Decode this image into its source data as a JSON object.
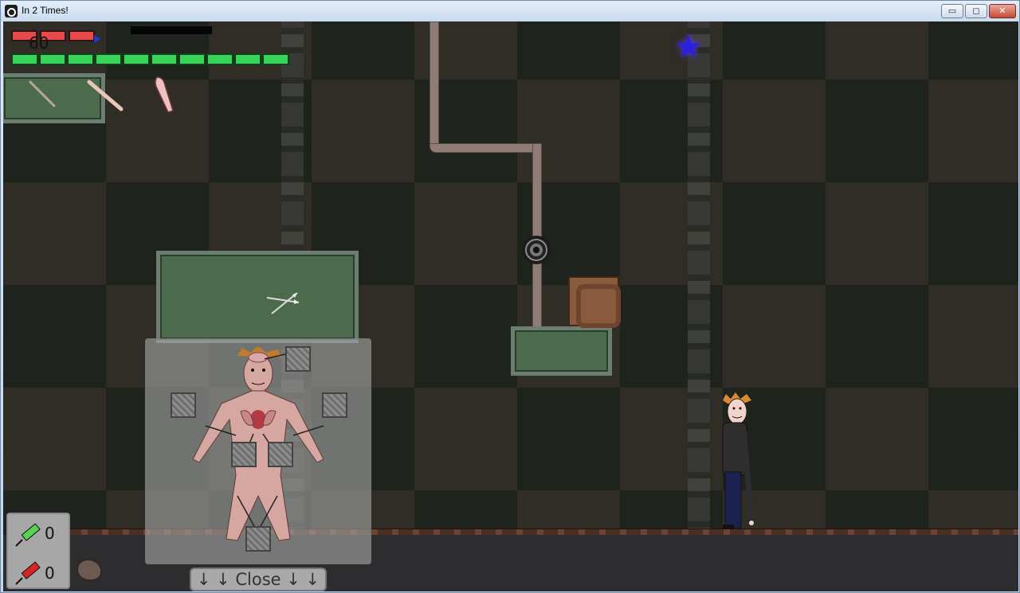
{
  "window": {
    "title": "In 2 Times!",
    "minimize_glyph": "▭",
    "maximize_glyph": "◻",
    "close_glyph": "✕"
  },
  "hud": {
    "health_value": "60",
    "health_segments_filled": 3,
    "stamina_segments_filled": 10,
    "health_color": "#e8494a",
    "stamina_color": "#38d45a"
  },
  "body_map": {
    "close_label": "↓ ↓ Close ↓ ↓"
  },
  "inventory": {
    "green_syringe_count": "0",
    "red_syringe_count": "0"
  },
  "colors": {
    "star": "#2b1fe0",
    "panel_green": "#4c6b4d",
    "crate": "#8a5a3d"
  }
}
